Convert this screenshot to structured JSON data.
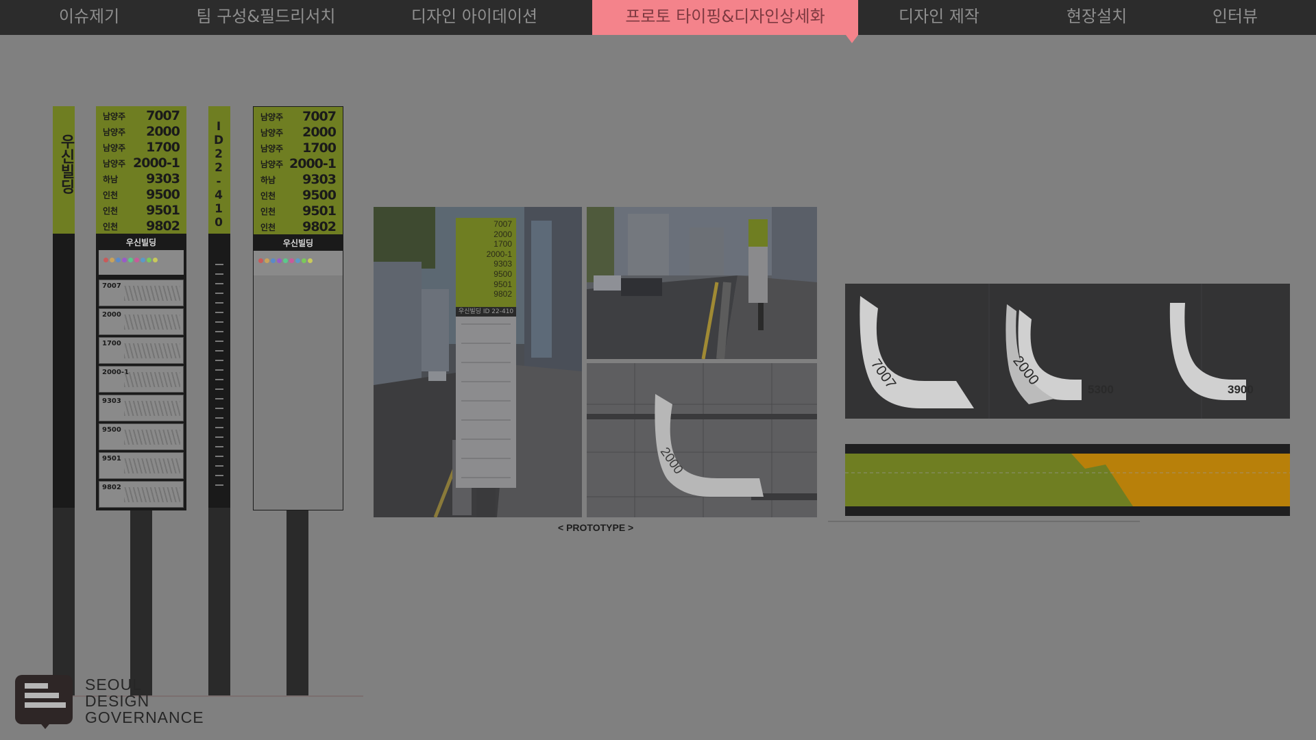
{
  "nav": {
    "items": [
      {
        "label": "이슈제기",
        "active": false
      },
      {
        "label": "팀 구성&필드리서치",
        "active": false
      },
      {
        "label": "디자인 아이데이션",
        "active": false
      },
      {
        "label": "프로토 타이핑&디자인상세화",
        "active": true
      },
      {
        "label": "디자인 제작",
        "active": false
      },
      {
        "label": "현장설치",
        "active": false
      },
      {
        "label": "인터뷰",
        "active": false
      }
    ]
  },
  "sign1": {
    "vertical_text": "우신빌딩"
  },
  "sign3": {
    "vertical_text": "ID22-410"
  },
  "routes": [
    {
      "region": "남양주",
      "number": "7007"
    },
    {
      "region": "남양주",
      "number": "2000"
    },
    {
      "region": "남양주",
      "number": "1700"
    },
    {
      "region": "남양주",
      "number": "2000-1"
    },
    {
      "region": "하남",
      "number": "9303"
    },
    {
      "region": "인천",
      "number": "9500"
    },
    {
      "region": "인천",
      "number": "9501"
    },
    {
      "region": "인천",
      "number": "9802"
    }
  ],
  "stop_name": "우신빌딩",
  "map_routes": [
    "7007",
    "2000",
    "1700",
    "2000-1",
    "9303",
    "9500",
    "9501",
    "9802"
  ],
  "photo_sign": {
    "numbers": [
      "7007",
      "2000",
      "1700",
      "2000-1",
      "9303",
      "9500",
      "9501",
      "9802"
    ],
    "stop": "우신빌딩 ID 22-410"
  },
  "floor_markers": [
    {
      "label": "7007"
    },
    {
      "label": "2000"
    },
    {
      "label": "5300"
    },
    {
      "label": "3900"
    }
  ],
  "floor_photo_label": "2000",
  "caption": "< PROTOTYPE >",
  "logo": {
    "line1": "SEOUL",
    "line2": "DESIGN",
    "line3": "GOVERNANCE"
  },
  "colors": {
    "accent": "#f4838b",
    "sign_green": "#6f7e22",
    "orange": "#b8800a"
  }
}
